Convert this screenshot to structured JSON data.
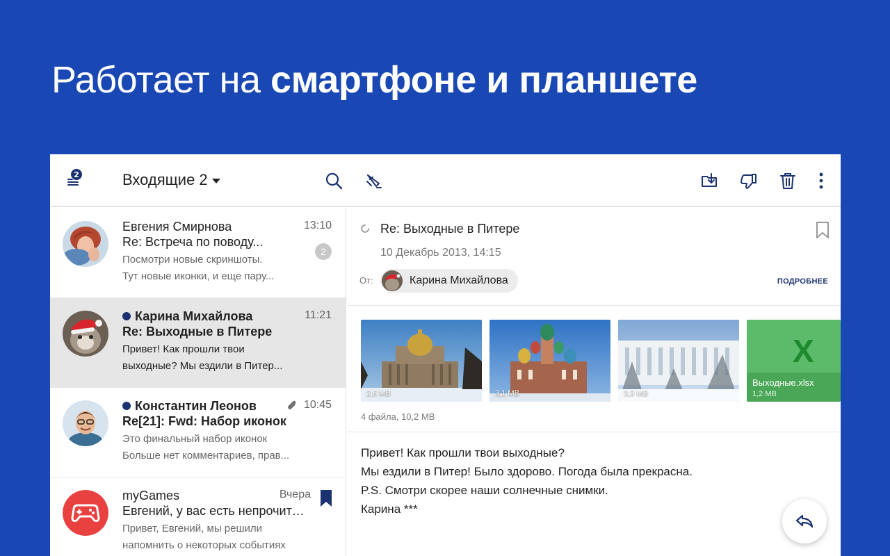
{
  "headline": {
    "light": "Работает на ",
    "bold": "смартфоне и планшете"
  },
  "toolbar": {
    "menu_badge": "2",
    "folder_title": "Входящие 2"
  },
  "messages": [
    {
      "sender": "Евгения Смирнова",
      "subject": "Re: Встреча по поводу...",
      "snippet_line1": "Посмотри новые скриншоты.",
      "snippet_line2": "Тут новые иконки, и еще пару...",
      "time": "13:10",
      "count": "2"
    },
    {
      "sender": "Карина Михайлова",
      "subject": "Re: Выходные в Питере",
      "snippet_line1": "Привет! Как прошли твои",
      "snippet_line2": "выходные? Мы ездили в Питер...",
      "time": "11:21"
    },
    {
      "sender": "Константин Леонов",
      "subject": "Re[21]: Fwd: Набор иконок",
      "snippet_line1": "Это финальный набор иконок",
      "snippet_line2": "Больше нет комментариев, прав...",
      "time": "10:45"
    },
    {
      "sender": "myGames",
      "subject": "Евгений, у вас есть непрочитанные",
      "snippet_line1": "Привет, Евгений, мы решили",
      "snippet_line2": "напомнить о некоторых событиях",
      "time": "Вчера"
    }
  ],
  "reader": {
    "subject": "Re: Выходные в Питере",
    "date": "10 Декабрь 2013, 14:15",
    "from_label": "От:",
    "from_name": "Карина Михайлова",
    "details_link": "ПОДРОБНЕЕ",
    "attachments": [
      {
        "size": "2,6 MB"
      },
      {
        "size": "3,1 MB"
      },
      {
        "size": "3,3 MB"
      },
      {
        "name": "Выходные.xlsx",
        "size": "1,2 MB"
      }
    ],
    "attachments_summary": "4 файла, 10,2 MB",
    "body": [
      "Привет! Как прошли твои выходные?",
      "Мы ездили в Питер! Было здорово. Погода была прекрасна.",
      "P.S. Смотри скорее наши солнечные снимки.",
      "Карина ***"
    ]
  },
  "colors": {
    "background": "#1947b3",
    "accent": "#1b3270",
    "unread_dot": "#1b3270",
    "xlsx_green": "#5cbb6a",
    "game_red": "#e8413f"
  },
  "icons": {
    "menu": "menu-icon",
    "search": "search-icon",
    "compose": "compose-icon",
    "move": "move-to-folder-icon",
    "spam": "thumbs-down-icon",
    "delete": "trash-icon",
    "more": "more-vert-icon",
    "reply": "reply-icon"
  }
}
